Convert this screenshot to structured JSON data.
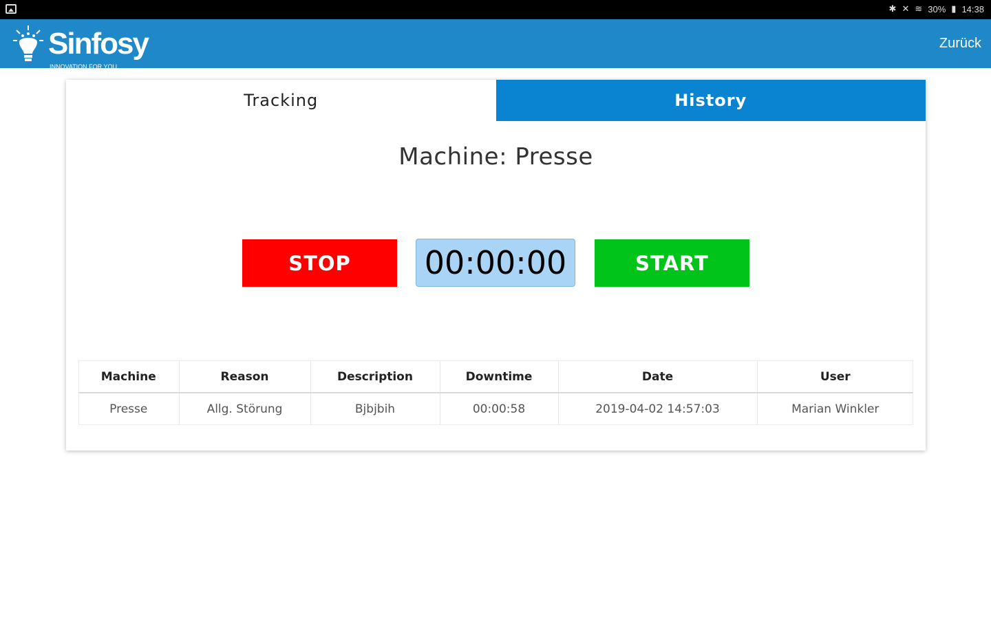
{
  "app": {
    "brand_name": "Sinfosy",
    "brand_tagline": "INNOVATION FOR YOU",
    "back_label": "Zurück",
    "colors": {
      "header": "#1e88c8",
      "tab_inactive": "#0a84d0",
      "stop": "#ff0000",
      "start": "#00c41a",
      "timer": "#a9d4f5"
    }
  },
  "statusbar": {
    "icons": [
      "image-icon",
      "bluetooth-icon",
      "mute-icon",
      "wifi-icon",
      "battery-icon"
    ],
    "battery": "30%",
    "time": "14:38"
  },
  "tabs": [
    {
      "label": "Tracking",
      "active": true
    },
    {
      "label": "History",
      "active": false
    }
  ],
  "tracking": {
    "machine_title": "Machine: Presse",
    "stop_label": "STOP",
    "timer": "00:00:00",
    "start_label": "START"
  },
  "table": {
    "headers": [
      "Machine",
      "Reason",
      "Description",
      "Downtime",
      "Date",
      "User"
    ],
    "rows": [
      [
        "Presse",
        "Allg. Störung",
        "Bjbjbih",
        "00:00:58",
        "2019-04-02 14:57:03",
        "Marian Winkler"
      ]
    ]
  }
}
